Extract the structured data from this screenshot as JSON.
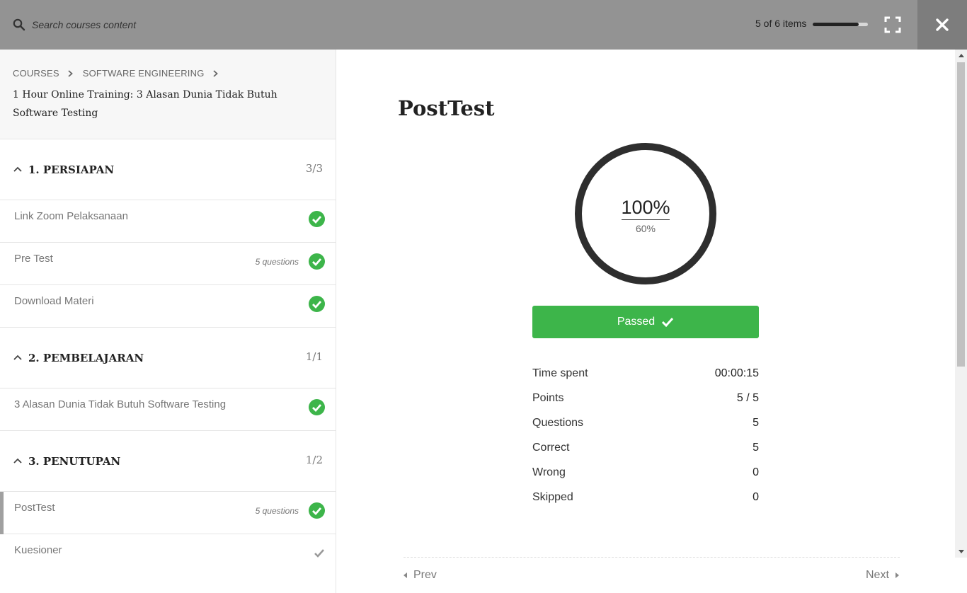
{
  "topbar": {
    "search_placeholder": "Search courses content",
    "items_count": "5 of 6 items",
    "progress_fraction": 0.83
  },
  "sidebar": {
    "breadcrumb": [
      "COURSES",
      "SOFTWARE ENGINEERING"
    ],
    "course_title": "1 Hour Online Training: 3 Alasan Dunia Tidak Butuh Software Testing",
    "sections": [
      {
        "title": "1. PERSIAPAN",
        "count": "3/3",
        "items": [
          {
            "title": "Link Zoom Pelaksanaan",
            "meta": "",
            "status": "completed"
          },
          {
            "title": "Pre Test",
            "meta": "5 questions",
            "status": "completed"
          },
          {
            "title": "Download Materi",
            "meta": "",
            "status": "completed"
          }
        ]
      },
      {
        "title": "2. PEMBELAJARAN",
        "count": "1/1",
        "items": [
          {
            "title": "3 Alasan Dunia Tidak Butuh Software Testing",
            "meta": "",
            "status": "completed"
          }
        ]
      },
      {
        "title": "3. PENUTUPAN",
        "count": "1/2",
        "items": [
          {
            "title": "PostTest",
            "meta": "5 questions",
            "status": "completed",
            "active": true
          },
          {
            "title": "Kuesioner",
            "meta": "",
            "status": "unfinished"
          }
        ]
      }
    ]
  },
  "main": {
    "title": "PostTest",
    "score": "100%",
    "passing_grade": "60%",
    "result_label": "Passed",
    "stats": [
      {
        "label": "Time spent",
        "value": "00:00:15"
      },
      {
        "label": "Points",
        "value": "5 / 5"
      },
      {
        "label": "Questions",
        "value": "5"
      },
      {
        "label": "Correct",
        "value": "5"
      },
      {
        "label": "Wrong",
        "value": "0"
      },
      {
        "label": "Skipped",
        "value": "0"
      }
    ],
    "prev_label": "Prev",
    "next_label": "Next"
  },
  "colors": {
    "topbar": "#939393",
    "close_bg": "#7d7d7d",
    "success": "#3db54a",
    "ring": "#2e2e2e"
  }
}
